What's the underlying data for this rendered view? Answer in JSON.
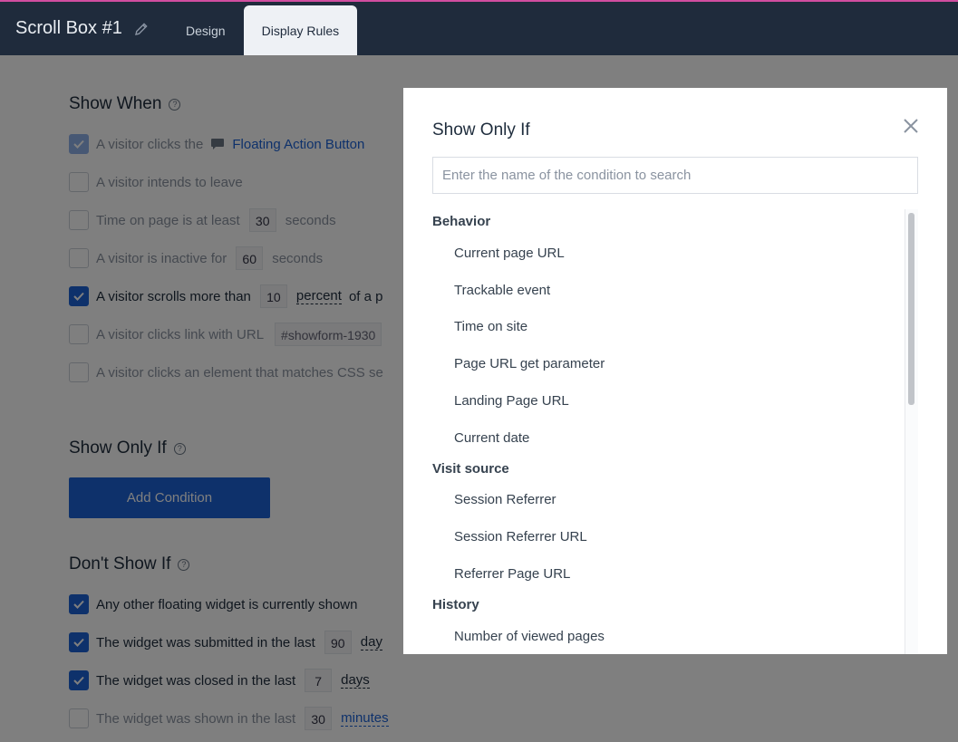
{
  "app": {
    "title": "Scroll Box #1",
    "tabs": [
      {
        "label": "Design"
      },
      {
        "label": "Display Rules"
      }
    ]
  },
  "show_when": {
    "title": "Show When",
    "rules": [
      {
        "text": "A visitor clicks the",
        "checked": true,
        "link": "Floating Action Button"
      },
      {
        "text": "A visitor intends to leave",
        "checked": false
      },
      {
        "text": "Time on page is at least",
        "checked": false,
        "value": "30",
        "unit": "seconds"
      },
      {
        "text": "A visitor is inactive for",
        "checked": false,
        "value": "60",
        "unit": "seconds"
      },
      {
        "text": "A visitor scrolls more than",
        "checked": true,
        "value": "10",
        "unit": "percent",
        "suffix": "of a p"
      },
      {
        "text": "A visitor clicks link with URL",
        "checked": false,
        "value": "#showform-1930"
      },
      {
        "text": "A visitor clicks an element that matches CSS se",
        "checked": false
      }
    ]
  },
  "show_only_if": {
    "title": "Show Only If",
    "add_button": "Add Condition"
  },
  "dont_show_if": {
    "title": "Don't Show If",
    "rules": [
      {
        "text": "Any other floating widget is currently shown",
        "checked": true
      },
      {
        "text": "The widget was submitted in the last",
        "checked": true,
        "value": "90",
        "unit": "day"
      },
      {
        "text": "The widget was closed in the last",
        "checked": true,
        "value": "7",
        "unit": "days"
      },
      {
        "text": "The widget was shown in the last",
        "checked": false,
        "value": "30",
        "unit": "minutes"
      }
    ]
  },
  "modal": {
    "title": "Show Only If",
    "search_placeholder": "Enter the name of the condition to search",
    "groups": [
      {
        "title": "Behavior",
        "items": [
          "Current page URL",
          "Trackable event",
          "Time on site",
          "Page URL get parameter",
          "Landing Page URL",
          "Current date"
        ]
      },
      {
        "title": "Visit source",
        "items": [
          "Session Referrer",
          "Session Referrer URL",
          "Referrer Page URL"
        ]
      },
      {
        "title": "History",
        "items": [
          "Number of viewed pages"
        ]
      }
    ]
  },
  "colors": {
    "accent": "#1d63d6",
    "topbar": "#1f2b3c",
    "top_stripe": "#d14da0"
  }
}
